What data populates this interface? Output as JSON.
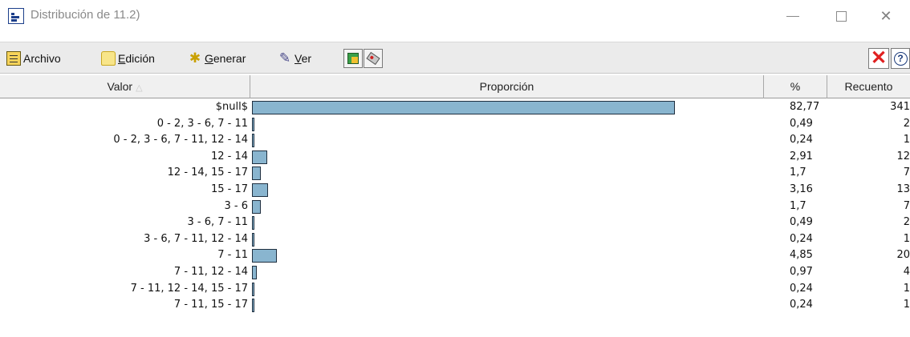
{
  "window": {
    "title": "Distribución de 11.2)",
    "minimize_glyph": "—",
    "close_glyph": "✕"
  },
  "menu": {
    "archivo": "Archivo",
    "edicion_accel": "E",
    "edicion_rest": "dición",
    "generar_accel": "G",
    "generar_rest": "enerar",
    "ver_accel": "V",
    "ver_rest": "er"
  },
  "toolbar": {
    "close_glyph": "✕",
    "help_glyph": "?"
  },
  "table": {
    "headers": {
      "valor": "Valor",
      "proporcion": "Proporción",
      "pct": "%",
      "recuento": "Recuento"
    },
    "sort_indicator": "△",
    "bar_color": "#89b5cf",
    "rows": [
      {
        "valor": "$null$",
        "pct": "82,77",
        "recuento": "341"
      },
      {
        "valor": "0 - 2, 3 - 6, 7 - 11",
        "pct": "0,49",
        "recuento": "2"
      },
      {
        "valor": "0 - 2, 3 - 6, 7 - 11, 12 - 14",
        "pct": "0,24",
        "recuento": "1"
      },
      {
        "valor": "12 - 14",
        "pct": "2,91",
        "recuento": "12"
      },
      {
        "valor": "12 - 14, 15 - 17",
        "pct": "1,7",
        "recuento": "7"
      },
      {
        "valor": "15 - 17",
        "pct": "3,16",
        "recuento": "13"
      },
      {
        "valor": "3 - 6",
        "pct": "1,7",
        "recuento": "7"
      },
      {
        "valor": "3 - 6, 7 - 11",
        "pct": "0,49",
        "recuento": "2"
      },
      {
        "valor": "3 - 6, 7 - 11, 12 - 14",
        "pct": "0,24",
        "recuento": "1"
      },
      {
        "valor": "7 - 11",
        "pct": "4,85",
        "recuento": "20"
      },
      {
        "valor": "7 - 11, 12 - 14",
        "pct": "0,97",
        "recuento": "4"
      },
      {
        "valor": "7 - 11, 12 - 14, 15 - 17",
        "pct": "0,24",
        "recuento": "1"
      },
      {
        "valor": "7 - 11, 15 - 17",
        "pct": "0,24",
        "recuento": "1"
      }
    ]
  }
}
